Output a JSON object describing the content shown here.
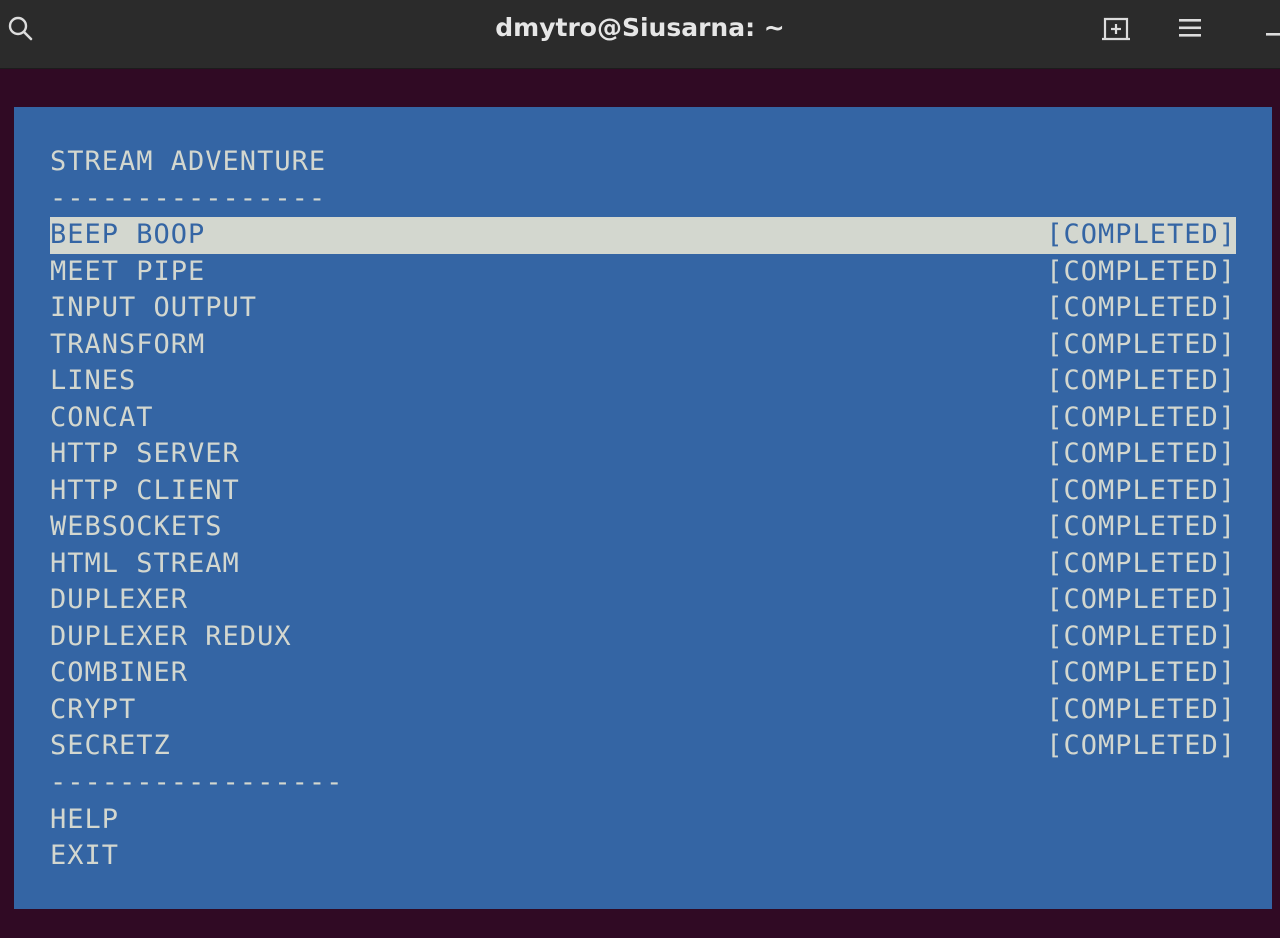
{
  "window": {
    "title": "dmytro@Siusarna: ~",
    "icons": {
      "search": "search-icon",
      "new_tab": "new-tab-icon",
      "menu": "hamburger-menu-icon",
      "minimize": "minimize-icon"
    }
  },
  "terminal": {
    "heading": "STREAM ADVENTURE",
    "separator_top": "----------------",
    "separator_bottom": "-----------------",
    "items": [
      {
        "label": "BEEP BOOP",
        "status": "[COMPLETED]",
        "selected": true
      },
      {
        "label": "MEET PIPE",
        "status": "[COMPLETED]"
      },
      {
        "label": "INPUT OUTPUT",
        "status": "[COMPLETED]"
      },
      {
        "label": "TRANSFORM",
        "status": "[COMPLETED]"
      },
      {
        "label": "LINES",
        "status": "[COMPLETED]"
      },
      {
        "label": "CONCAT",
        "status": "[COMPLETED]"
      },
      {
        "label": "HTTP SERVER",
        "status": "[COMPLETED]"
      },
      {
        "label": "HTTP CLIENT",
        "status": "[COMPLETED]"
      },
      {
        "label": "WEBSOCKETS",
        "status": "[COMPLETED]"
      },
      {
        "label": "HTML STREAM",
        "status": "[COMPLETED]"
      },
      {
        "label": "DUPLEXER",
        "status": "[COMPLETED]"
      },
      {
        "label": "DUPLEXER REDUX",
        "status": "[COMPLETED]"
      },
      {
        "label": "COMBINER",
        "status": "[COMPLETED]"
      },
      {
        "label": "CRYPT",
        "status": "[COMPLETED]"
      },
      {
        "label": "SECRETZ",
        "status": "[COMPLETED]"
      }
    ],
    "help": "HELP",
    "exit": "EXIT"
  },
  "colors": {
    "titlebar": "#2b2b2b",
    "terminal_background": "#300a24",
    "menu_background": "#3465a4",
    "menu_text": "#d3d7cf",
    "selection_background": "#d3d7cf"
  }
}
